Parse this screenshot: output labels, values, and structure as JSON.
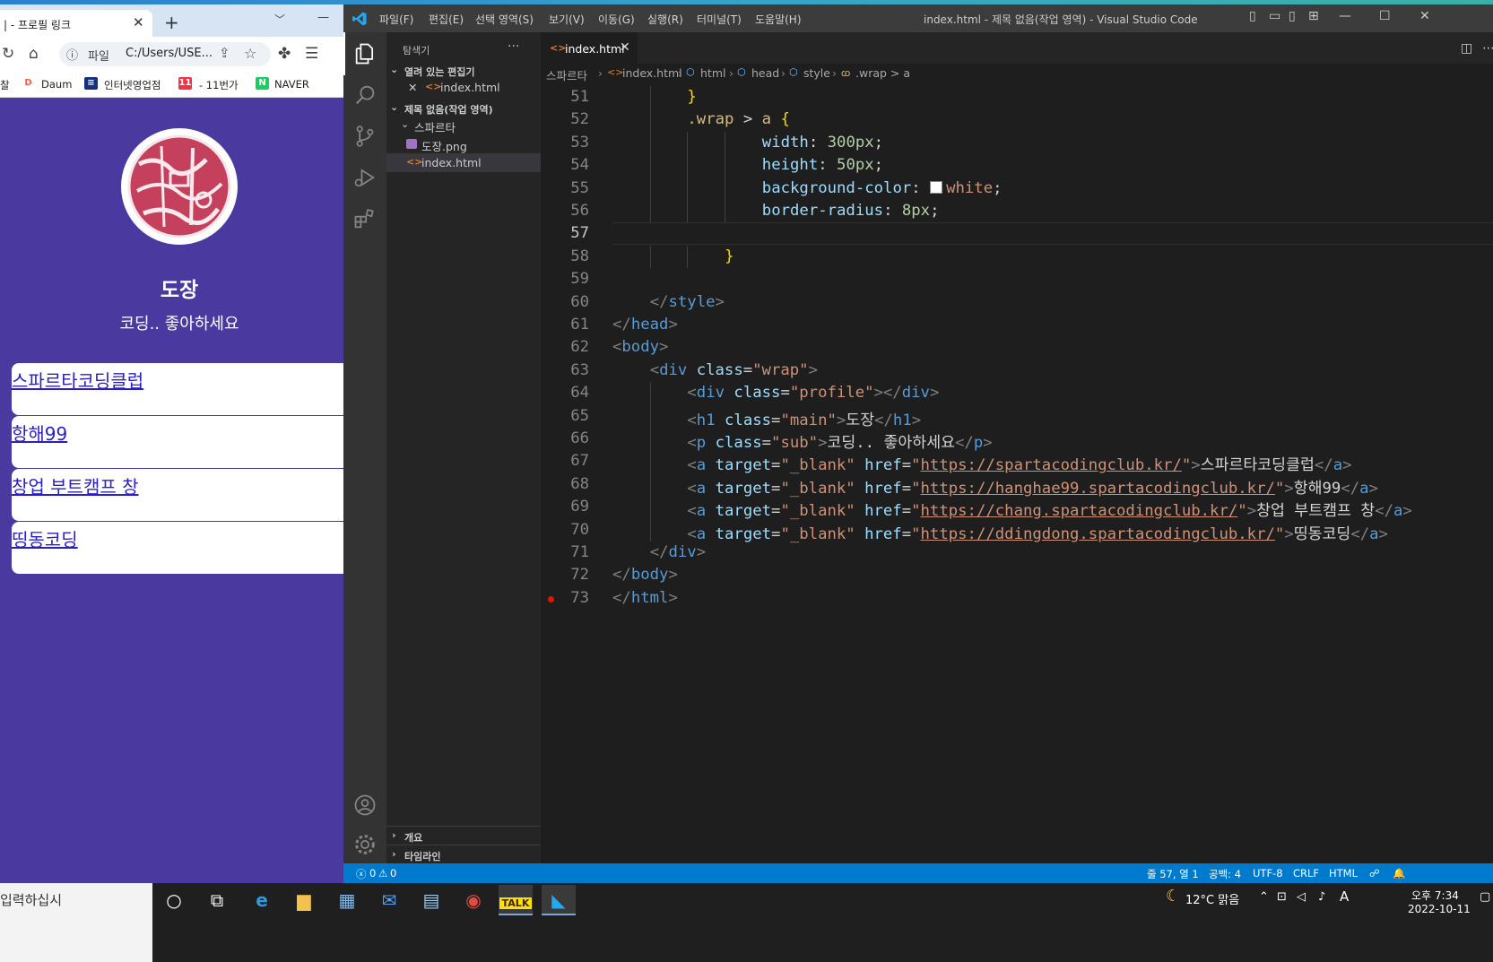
{
  "browser": {
    "tab_title": "| - 프로필 링크",
    "new_tab": "+",
    "tab_close": "✕",
    "toolbar": {
      "scheme": "파일",
      "url": "C:/Users/USE..."
    },
    "bookmarks": [
      {
        "label": "찰"
      },
      {
        "label": "Daum",
        "icon_text": "D",
        "color": "#ff5a3c"
      },
      {
        "label": "인터넷영업점",
        "icon_text": "≡",
        "color": "#17307c"
      },
      {
        "label": "- 11번가",
        "icon_text": "11",
        "color": "#f43142"
      },
      {
        "label": "NAVER",
        "icon_text": "N",
        "color": "#19ce60"
      }
    ],
    "page": {
      "title": "도장",
      "subtitle": "코딩.. 좋아하세요",
      "links": [
        "스파르타코딩클럽",
        "항해99",
        "창업 부트캠프 창",
        "띵동코딩"
      ]
    }
  },
  "vscode": {
    "menu": [
      "파일(F)",
      "편집(E)",
      "선택 영역(S)",
      "보기(V)",
      "이동(G)",
      "실행(R)",
      "터미널(T)",
      "도움말(H)"
    ],
    "window_title": "index.html - 제목 없음(작업 영역) - Visual Studio Code",
    "sidebar": {
      "header": "탐색기",
      "more": "···",
      "open_editors": "열려 있는 편집기",
      "open_editor_file": "index.html",
      "workspace": "제목 없음(작업 영역)",
      "folder": "스파르타",
      "files": [
        "도장.png",
        "index.html"
      ],
      "outline": "개요",
      "timeline": "타임라인"
    },
    "tab": {
      "label": "index.html",
      "close": "✕"
    },
    "breadcrumb": [
      "스파르타",
      "index.html",
      "html",
      "head",
      "style",
      ".wrap > a"
    ],
    "status": {
      "errors": "0",
      "warnings": "0",
      "position": "줄 57, 열 1",
      "spaces": "공백: 4",
      "encoding": "UTF-8",
      "eol": "CRLF",
      "language": "HTML"
    },
    "code": [
      {
        "n": "51",
        "indent": 2,
        "tokens": [
          [
            "t-brace",
            "}"
          ]
        ]
      },
      {
        "n": "52",
        "indent": 2,
        "tokens": [
          [
            "t-sel",
            ".wrap"
          ],
          [
            "t-txt",
            " > "
          ],
          [
            "t-sel",
            "a"
          ],
          [
            "t-txt",
            " "
          ],
          [
            "t-brace",
            "{"
          ]
        ]
      },
      {
        "n": "53",
        "indent": 4,
        "tokens": [
          [
            "t-prop",
            "width"
          ],
          [
            "t-txt",
            ": "
          ],
          [
            "t-num",
            "300px"
          ],
          [
            "t-txt",
            ";"
          ]
        ]
      },
      {
        "n": "54",
        "indent": 4,
        "tokens": [
          [
            "t-prop",
            "height"
          ],
          [
            "t-txt",
            ": "
          ],
          [
            "t-num",
            "50px"
          ],
          [
            "t-txt",
            ";"
          ]
        ]
      },
      {
        "n": "55",
        "indent": 4,
        "tokens": [
          [
            "t-prop",
            "background-color"
          ],
          [
            "t-txt",
            ": "
          ],
          [
            "swatch",
            ""
          ],
          [
            "t-str",
            "white"
          ],
          [
            "t-txt",
            ";"
          ]
        ]
      },
      {
        "n": "56",
        "indent": 4,
        "tokens": [
          [
            "t-prop",
            "border-radius"
          ],
          [
            "t-txt",
            ": "
          ],
          [
            "t-num",
            "8px"
          ],
          [
            "t-txt",
            ";"
          ]
        ]
      },
      {
        "n": "57",
        "indent": 0,
        "tokens": []
      },
      {
        "n": "58",
        "indent": 3,
        "tokens": [
          [
            "t-brace",
            "}"
          ]
        ]
      },
      {
        "n": "59",
        "indent": 0,
        "tokens": []
      },
      {
        "n": "60",
        "indent": 1,
        "tokens": [
          [
            "t-punct",
            "</"
          ],
          [
            "t-tag",
            "style"
          ],
          [
            "t-punct",
            ">"
          ]
        ]
      },
      {
        "n": "61",
        "indent": 0,
        "tokens": [
          [
            "t-punct",
            "</"
          ],
          [
            "t-tag",
            "head"
          ],
          [
            "t-punct",
            ">"
          ]
        ]
      },
      {
        "n": "62",
        "indent": 0,
        "tokens": [
          [
            "t-punct",
            "<"
          ],
          [
            "t-tag",
            "body"
          ],
          [
            "t-punct",
            ">"
          ]
        ]
      },
      {
        "n": "63",
        "indent": 1,
        "tokens": [
          [
            "t-punct",
            "<"
          ],
          [
            "t-tag",
            "div"
          ],
          [
            "t-txt",
            " "
          ],
          [
            "t-attr",
            "class"
          ],
          [
            "t-txt",
            "="
          ],
          [
            "t-str",
            "\"wrap\""
          ],
          [
            "t-punct",
            ">"
          ]
        ]
      },
      {
        "n": "64",
        "indent": 2,
        "tokens": [
          [
            "t-punct",
            "<"
          ],
          [
            "t-tag",
            "div"
          ],
          [
            "t-txt",
            " "
          ],
          [
            "t-attr",
            "class"
          ],
          [
            "t-txt",
            "="
          ],
          [
            "t-str",
            "\"profile\""
          ],
          [
            "t-punct",
            "></"
          ],
          [
            "t-tag",
            "div"
          ],
          [
            "t-punct",
            ">"
          ]
        ]
      },
      {
        "n": "65",
        "indent": 2,
        "tokens": [
          [
            "t-punct",
            "<"
          ],
          [
            "t-tag",
            "h1"
          ],
          [
            "t-txt",
            " "
          ],
          [
            "t-attr",
            "class"
          ],
          [
            "t-txt",
            "="
          ],
          [
            "t-str",
            "\"main\""
          ],
          [
            "t-punct",
            ">"
          ],
          [
            "t-txt",
            "도장"
          ],
          [
            "t-punct",
            "</"
          ],
          [
            "t-tag",
            "h1"
          ],
          [
            "t-punct",
            ">"
          ]
        ]
      },
      {
        "n": "66",
        "indent": 2,
        "tokens": [
          [
            "t-punct",
            "<"
          ],
          [
            "t-tag",
            "p"
          ],
          [
            "t-txt",
            " "
          ],
          [
            "t-attr",
            "class"
          ],
          [
            "t-txt",
            "="
          ],
          [
            "t-str",
            "\"sub\""
          ],
          [
            "t-punct",
            ">"
          ],
          [
            "t-txt",
            "코딩.. 좋아하세요"
          ],
          [
            "t-punct",
            "</"
          ],
          [
            "t-tag",
            "p"
          ],
          [
            "t-punct",
            ">"
          ]
        ]
      },
      {
        "n": "67",
        "indent": 2,
        "tokens": [
          [
            "t-punct",
            "<"
          ],
          [
            "t-tag",
            "a"
          ],
          [
            "t-txt",
            " "
          ],
          [
            "t-attr",
            "target"
          ],
          [
            "t-txt",
            "="
          ],
          [
            "t-str",
            "\"_blank\""
          ],
          [
            "t-txt",
            " "
          ],
          [
            "t-attr",
            "href"
          ],
          [
            "t-txt",
            "="
          ],
          [
            "t-str",
            "\""
          ],
          [
            "t-url",
            "https://spartacodingclub.kr/"
          ],
          [
            "t-str",
            "\""
          ],
          [
            "t-punct",
            ">"
          ],
          [
            "t-txt",
            "스파르타코딩클럽"
          ],
          [
            "t-punct",
            "</"
          ],
          [
            "t-tag",
            "a"
          ],
          [
            "t-punct",
            ">"
          ]
        ]
      },
      {
        "n": "68",
        "indent": 2,
        "tokens": [
          [
            "t-punct",
            "<"
          ],
          [
            "t-tag",
            "a"
          ],
          [
            "t-txt",
            " "
          ],
          [
            "t-attr",
            "target"
          ],
          [
            "t-txt",
            "="
          ],
          [
            "t-str",
            "\"_blank\""
          ],
          [
            "t-txt",
            " "
          ],
          [
            "t-attr",
            "href"
          ],
          [
            "t-txt",
            "="
          ],
          [
            "t-str",
            "\""
          ],
          [
            "t-url",
            "https://hanghae99.spartacodingclub.kr/"
          ],
          [
            "t-str",
            "\""
          ],
          [
            "t-punct",
            ">"
          ],
          [
            "t-txt",
            "항해99"
          ],
          [
            "t-punct",
            "</"
          ],
          [
            "t-tag",
            "a"
          ],
          [
            "t-punct",
            ">"
          ]
        ]
      },
      {
        "n": "69",
        "indent": 2,
        "tokens": [
          [
            "t-punct",
            "<"
          ],
          [
            "t-tag",
            "a"
          ],
          [
            "t-txt",
            " "
          ],
          [
            "t-attr",
            "target"
          ],
          [
            "t-txt",
            "="
          ],
          [
            "t-str",
            "\"_blank\""
          ],
          [
            "t-txt",
            " "
          ],
          [
            "t-attr",
            "href"
          ],
          [
            "t-txt",
            "="
          ],
          [
            "t-str",
            "\""
          ],
          [
            "t-url",
            "https://chang.spartacodingclub.kr/"
          ],
          [
            "t-str",
            "\""
          ],
          [
            "t-punct",
            ">"
          ],
          [
            "t-txt",
            "창업 부트캠프 창"
          ],
          [
            "t-punct",
            "</"
          ],
          [
            "t-tag",
            "a"
          ],
          [
            "t-punct",
            ">"
          ]
        ]
      },
      {
        "n": "70",
        "indent": 2,
        "tokens": [
          [
            "t-punct",
            "<"
          ],
          [
            "t-tag",
            "a"
          ],
          [
            "t-txt",
            " "
          ],
          [
            "t-attr",
            "target"
          ],
          [
            "t-txt",
            "="
          ],
          [
            "t-str",
            "\"_blank\""
          ],
          [
            "t-txt",
            " "
          ],
          [
            "t-attr",
            "href"
          ],
          [
            "t-txt",
            "="
          ],
          [
            "t-str",
            "\""
          ],
          [
            "t-url",
            "https://ddingdong.spartacodingclub.kr/"
          ],
          [
            "t-str",
            "\""
          ],
          [
            "t-punct",
            ">"
          ],
          [
            "t-txt",
            "띵동코딩"
          ],
          [
            "t-punct",
            "</"
          ],
          [
            "t-tag",
            "a"
          ],
          [
            "t-punct",
            ">"
          ]
        ]
      },
      {
        "n": "71",
        "indent": 1,
        "tokens": [
          [
            "t-punct",
            "</"
          ],
          [
            "t-tag",
            "div"
          ],
          [
            "t-punct",
            ">"
          ]
        ]
      },
      {
        "n": "72",
        "indent": 0,
        "tokens": [
          [
            "t-punct",
            "</"
          ],
          [
            "t-tag",
            "body"
          ],
          [
            "t-punct",
            ">"
          ]
        ]
      },
      {
        "n": "73",
        "indent": 0,
        "tokens": [
          [
            "t-punct",
            "</"
          ],
          [
            "t-tag",
            "html"
          ],
          [
            "t-punct",
            ">"
          ]
        ]
      }
    ]
  },
  "taskbar": {
    "search_placeholder": "입력하십시",
    "weather": "12°C 맑음",
    "ime": "A",
    "time": "오후 7:34",
    "date": "2022-10-11",
    "apps": [
      "start-circle-icon",
      "task-view-icon",
      "ie-icon",
      "file-explorer-icon",
      "store-icon",
      "mail-icon",
      "notepad-icon",
      "chrome-icon",
      "kakaotalk-icon",
      "vscode-icon"
    ]
  }
}
